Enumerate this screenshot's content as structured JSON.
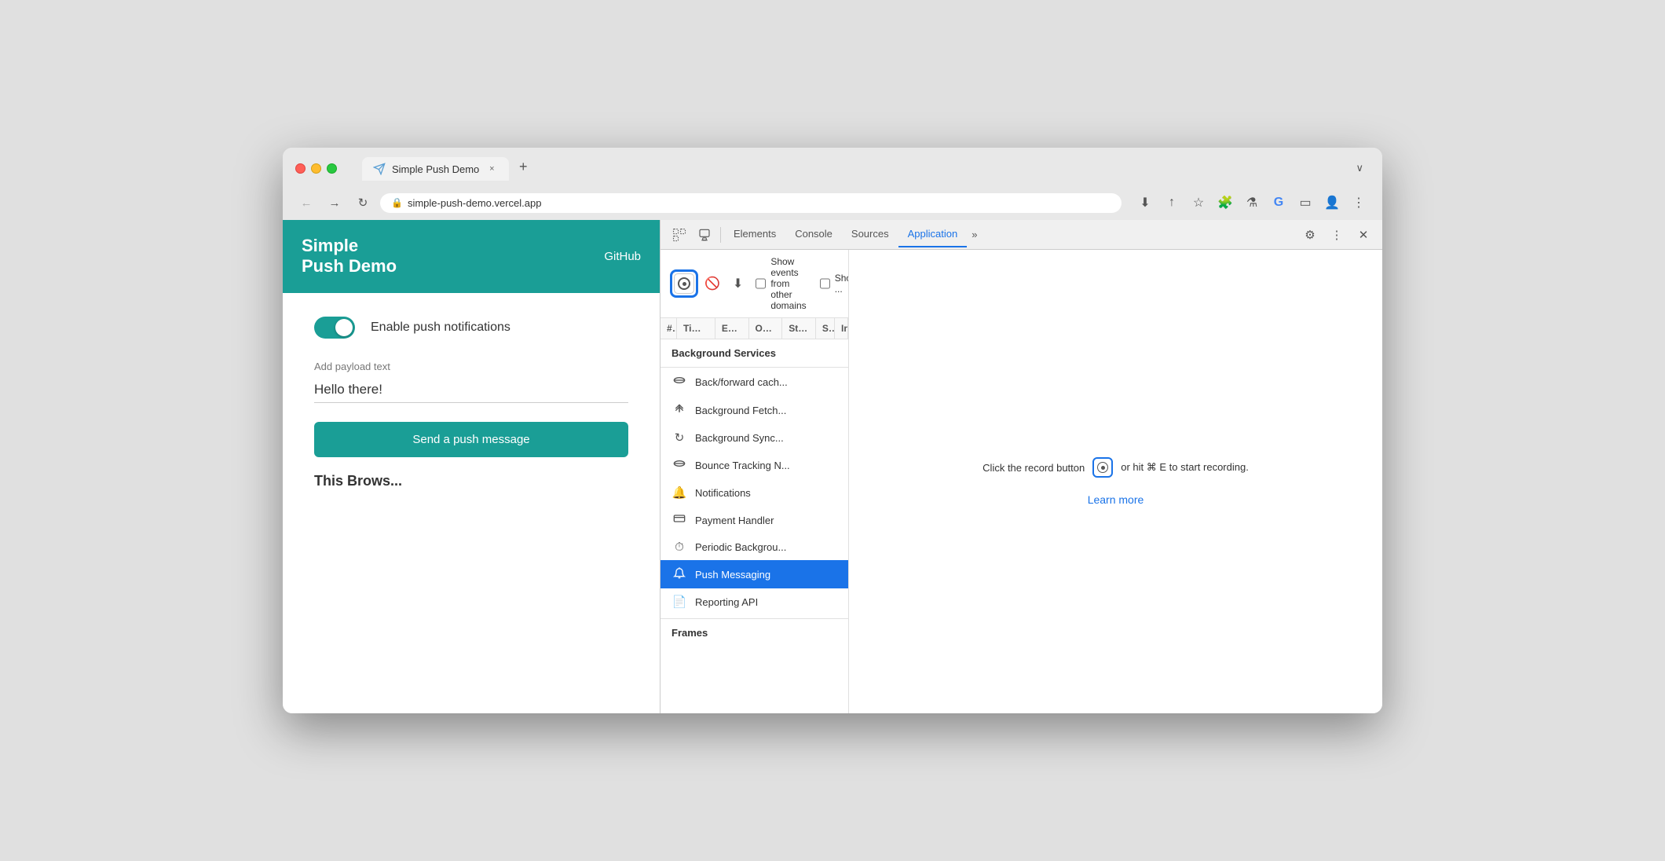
{
  "browser": {
    "tab_title": "Simple Push Demo",
    "tab_close": "×",
    "new_tab": "+",
    "overflow": "∨",
    "url": "simple-push-demo.vercel.app",
    "nav": {
      "back": "←",
      "forward": "→",
      "refresh": "↻"
    }
  },
  "website": {
    "title_line1": "Simple",
    "title_line2": "Push Demo",
    "github_label": "GitHub",
    "toggle_label": "Enable push notifications",
    "payload_label": "Add payload text",
    "payload_value": "Hello there!",
    "send_button": "Send a push message",
    "this_browser": "This Brows..."
  },
  "devtools": {
    "tabs": {
      "elements": "Elements",
      "console": "Console",
      "sources": "Sources",
      "application": "Application",
      "more": "»"
    },
    "toolbar": {
      "show_events_label": "Show events from other domains",
      "show_label": "Show ..."
    },
    "sidebar": {
      "header": "Background Services",
      "items": [
        {
          "label": "Back/forward cach...",
          "icon": "🗄"
        },
        {
          "label": "Background Fetch...",
          "icon": "↑↓"
        },
        {
          "label": "Background Sync...",
          "icon": "↻"
        },
        {
          "label": "Bounce Tracking N...",
          "icon": "🗄"
        },
        {
          "label": "Notifications",
          "icon": "🔔"
        },
        {
          "label": "Payment Handler",
          "icon": "🪙"
        },
        {
          "label": "Periodic Backgrou...",
          "icon": "⏱"
        },
        {
          "label": "Push Messaging",
          "icon": "☁",
          "active": true
        },
        {
          "label": "Reporting API",
          "icon": "📄"
        }
      ],
      "frames_header": "Frames"
    },
    "table": {
      "headers": [
        "#",
        "Timest...",
        "Event",
        "Origin",
        "Storage ...",
        "S...",
        "Instance..."
      ]
    },
    "record_message": "Click the record button",
    "record_shortcut": "or hit ⌘ E to start recording.",
    "learn_more": "Learn more"
  }
}
